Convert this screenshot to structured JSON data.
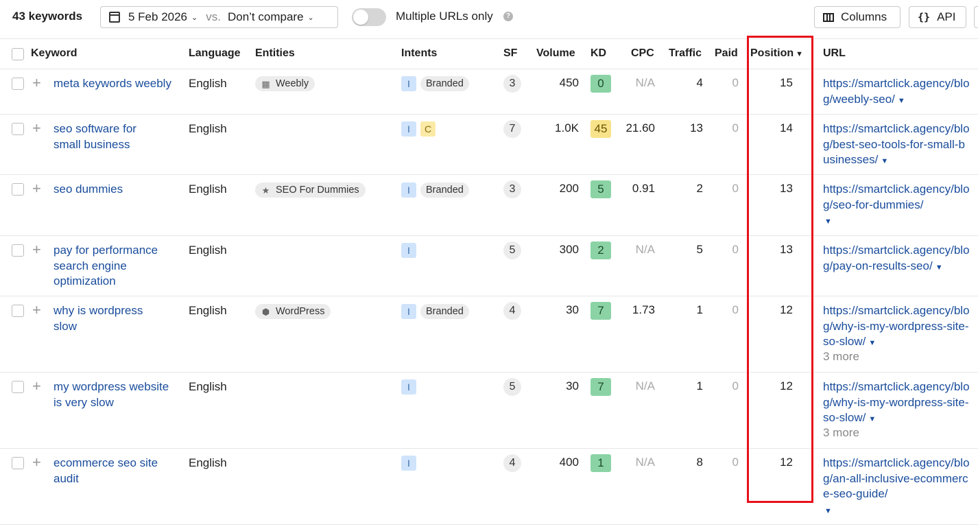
{
  "toolbar": {
    "keyword_count": "43 keywords",
    "date": "5 Feb 2026",
    "vs": "vs.",
    "compare": "Don’t compare",
    "multiple_urls_label": "Multiple URLs only",
    "help": "?",
    "columns_label": "Columns",
    "api_label": "API",
    "api_icon": "{}"
  },
  "columns": {
    "keyword": "Keyword",
    "language": "Language",
    "entities": "Entities",
    "intents": "Intents",
    "sf": "SF",
    "volume": "Volume",
    "kd": "KD",
    "cpc": "CPC",
    "traffic": "Traffic",
    "paid": "Paid",
    "position": "Position",
    "url": "URL"
  },
  "rows": [
    {
      "keyword": "meta keywords weebly",
      "language": "English",
      "entity": "Weebly",
      "intent_i": "I",
      "intent_c": "",
      "branded": "Branded",
      "sf": "3",
      "volume": "450",
      "kd": "0",
      "cpc": "N/A",
      "traffic": "4",
      "paid": "0",
      "position": "15",
      "url": "https://smartclick.agency/blog/weebly-seo/",
      "more": ""
    },
    {
      "keyword": "seo software for small business",
      "language": "English",
      "entity": "",
      "intent_i": "I",
      "intent_c": "C",
      "branded": "",
      "sf": "7",
      "volume": "1.0K",
      "kd": "45",
      "cpc": "21.60",
      "traffic": "13",
      "paid": "0",
      "position": "14",
      "url": "https://smartclick.agency/blog/best-seo-tools-for-small-businesses/",
      "more": ""
    },
    {
      "keyword": "seo dummies",
      "language": "English",
      "entity": "SEO For Dummies",
      "intent_i": "I",
      "intent_c": "",
      "branded": "Branded",
      "sf": "3",
      "volume": "200",
      "kd": "5",
      "cpc": "0.91",
      "traffic": "2",
      "paid": "0",
      "position": "13",
      "url": "https://smartclick.agency/blog/seo-for-dummies/",
      "more": ""
    },
    {
      "keyword": "pay for performance search engine optimization",
      "language": "English",
      "entity": "",
      "intent_i": "I",
      "intent_c": "",
      "branded": "",
      "sf": "5",
      "volume": "300",
      "kd": "2",
      "cpc": "N/A",
      "traffic": "5",
      "paid": "0",
      "position": "13",
      "url": "https://smartclick.agency/blog/pay-on-results-seo/",
      "more": ""
    },
    {
      "keyword": "why is wordpress slow",
      "language": "English",
      "entity": "WordPress",
      "intent_i": "I",
      "intent_c": "",
      "branded": "Branded",
      "sf": "4",
      "volume": "30",
      "kd": "7",
      "cpc": "1.73",
      "traffic": "1",
      "paid": "0",
      "position": "12",
      "url": "https://smartclick.agency/blog/why-is-my-wordpress-site-so-slow/",
      "more": "3 more"
    },
    {
      "keyword": "my wordpress website is very slow",
      "language": "English",
      "entity": "",
      "intent_i": "I",
      "intent_c": "",
      "branded": "",
      "sf": "5",
      "volume": "30",
      "kd": "7",
      "cpc": "N/A",
      "traffic": "1",
      "paid": "0",
      "position": "12",
      "url": "https://smartclick.agency/blog/why-is-my-wordpress-site-so-slow/",
      "more": "3 more"
    },
    {
      "keyword": "ecommerce seo site audit",
      "language": "English",
      "entity": "",
      "intent_i": "I",
      "intent_c": "",
      "branded": "",
      "sf": "4",
      "volume": "400",
      "kd": "1",
      "cpc": "N/A",
      "traffic": "8",
      "paid": "0",
      "position": "12",
      "url": "https://smartclick.agency/blog/an-all-inclusive-ecommerce-seo-guide/",
      "more": ""
    }
  ],
  "colors": {
    "link": "#1a4d9c",
    "kd_green": "#8bd3a5",
    "kd_yellow": "#f8e38a",
    "intent_i": "#cfe3fb",
    "intent_c": "#fbe9a6",
    "highlight": "#e8101a"
  },
  "icons": {
    "calendar": "calendar-icon",
    "columns": "columns-icon",
    "building": "building-icon",
    "star": "star-icon",
    "cube": "cube-icon",
    "plus": "plus-icon",
    "caret": "caret-down-icon"
  }
}
